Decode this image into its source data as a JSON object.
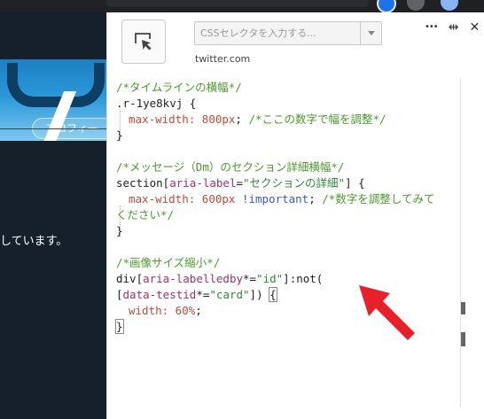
{
  "left": {
    "profile_button": "プロフィー",
    "bio_text": "しています。"
  },
  "stylus": {
    "selector_placeholder": "CSSセレクタを入力する...",
    "domain": "twitter.com",
    "ctrl_more": "•••",
    "ctrl_resize": "⇹",
    "ctrl_close": "✕"
  },
  "code": {
    "l1": "/*タイムラインの横幅*/",
    "l2_sel": ".r-1ye8kvj",
    "l2_brace": " {",
    "l3_prop": "max-width:",
    "l3_val": " 800px",
    "l3_semi": ";",
    "l3_comment": " /*ここの数字で幅を調整*/",
    "l4": "}",
    "l6": "/*メッセージ（Dm）のセクション詳細横幅*/",
    "l7_sel": "section[",
    "l7_attr": "aria-label",
    "l7_eq": "=",
    "l7_str": "\"セクションの詳細\"",
    "l7_end": "] {",
    "l8_prop": "max-width:",
    "l8_val": " 600px ",
    "l8_imp": "!important",
    "l8_semi": ";",
    "l8_comment": " /*数字を調整してみて",
    "l9_comment": "ください*/",
    "l10": "}",
    "l12": "/*画像サイズ縮小*/",
    "l13_sel": "div[",
    "l13_attr": "aria-labelledby",
    "l13_eq": "*=",
    "l13_str": "\"id\"",
    "l13_end": "]:not(",
    "l14_sel": "[",
    "l14_attr": "data-testid",
    "l14_eq": "*=",
    "l14_str": "\"card\"",
    "l14_end": "]) ",
    "l14_brace": "{",
    "l15_prop": "width:",
    "l15_val": " 60%",
    "l15_semi": ";",
    "l16": "}"
  },
  "colors": {
    "arrow": "#e8202a",
    "comment": "#4a9a2c",
    "page_bg": "#15202b"
  }
}
